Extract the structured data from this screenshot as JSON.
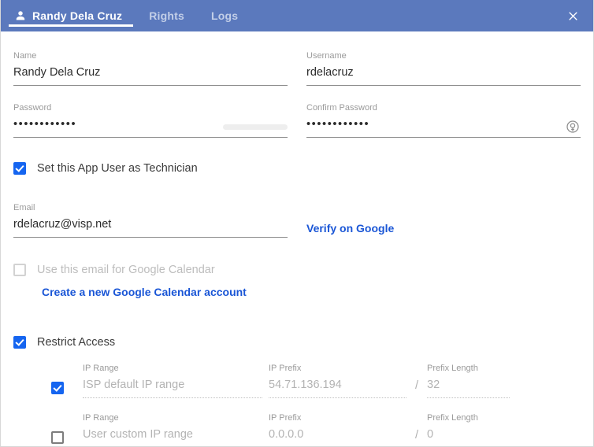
{
  "header": {
    "tabs": [
      {
        "label": "Randy Dela Cruz",
        "icon": "user-icon",
        "active": true
      },
      {
        "label": "Rights",
        "active": false
      },
      {
        "label": "Logs",
        "active": false
      }
    ],
    "close_icon": "close-icon",
    "background_color": "#5b79bd"
  },
  "form": {
    "name": {
      "label": "Name",
      "value": "Randy Dela Cruz"
    },
    "username": {
      "label": "Username",
      "value": "rdelacruz"
    },
    "password": {
      "label": "Password",
      "value": "••••••••••••",
      "strength_meter": true
    },
    "confirm_password": {
      "label": "Confirm Password",
      "value": "••••••••••••",
      "action_icon": "password-generate-icon"
    },
    "technician": {
      "label": "Set this App User as Technician",
      "checked": true
    },
    "email": {
      "label": "Email",
      "value": "rdelacruz@visp.net"
    },
    "verify_link": "Verify on Google",
    "google_calendar": {
      "label": "Use this email for Google Calendar",
      "checked": false,
      "disabled": true
    },
    "create_calendar_link": "Create a new Google Calendar account",
    "restrict_access": {
      "label": "Restrict Access",
      "checked": true
    }
  },
  "ip_table": {
    "columns": {
      "range": "IP Range",
      "prefix": "IP Prefix",
      "length": "Prefix Length"
    },
    "separator": "/",
    "rows": [
      {
        "checked": true,
        "range_placeholder": "ISP default IP range",
        "prefix": "54.71.136.194",
        "length": "32"
      },
      {
        "checked": false,
        "range_placeholder": "User custom IP range",
        "prefix": "0.0.0.0",
        "length": "0"
      }
    ]
  },
  "colors": {
    "header_blue": "#5b79bd",
    "checkbox_blue": "#1565f0",
    "link_blue": "#1a56d6"
  }
}
